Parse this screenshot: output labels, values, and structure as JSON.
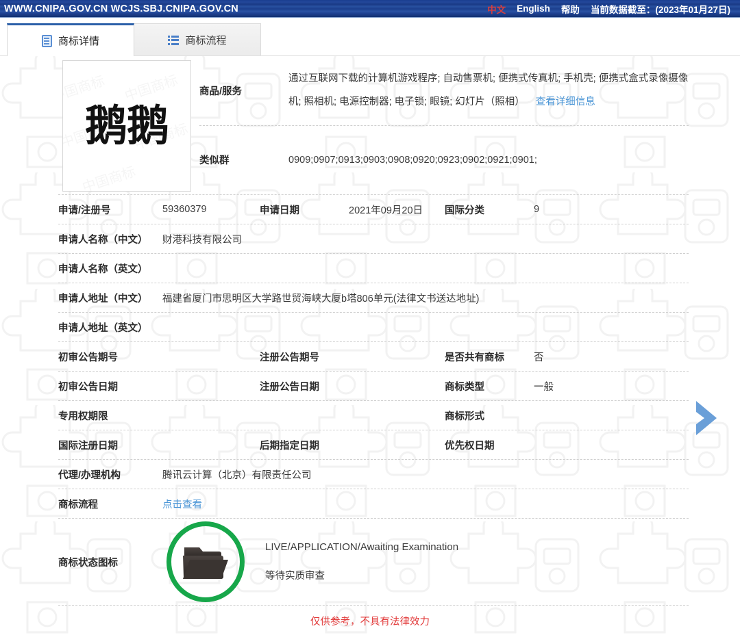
{
  "topbar": {
    "url": "WWW.CNIPA.GOV.CN WCJS.SBJ.CNIPA.GOV.CN",
    "lang_cn": "中文",
    "lang_en": "English",
    "help": "帮助",
    "data_date": "当前数据截至：(2023年01月27日)",
    "bg_color": "#1b3f8f",
    "cn_color": "#d63f3f"
  },
  "tabs": [
    {
      "label": "商标详情",
      "icon": "clipboard-icon",
      "active": true
    },
    {
      "label": "商标流程",
      "icon": "list-icon",
      "active": false
    }
  ],
  "mark": {
    "image_text": "鹅鹅",
    "watermark_text": "中国商标"
  },
  "goods": {
    "label": "商品/服务",
    "value": "通过互联网下载的计算机游戏程序; 自动售票机; 便携式传真机; 手机壳; 便携式盒式录像摄像机; 照相机; 电源控制器; 电子锁; 眼镜; 幻灯片（照相）",
    "detail_link": "查看详细信息"
  },
  "similar_group": {
    "label": "类似群",
    "value": "0909;0907;0913;0903;0908;0920;0923;0902;0921;0901;"
  },
  "fields": {
    "app_no": {
      "label": "申请/注册号",
      "value": "59360379"
    },
    "app_date": {
      "label": "申请日期",
      "value": "2021年09月20日"
    },
    "intl_class": {
      "label": "国际分类",
      "value": "9"
    },
    "applicant_cn": {
      "label": "申请人名称（中文）",
      "value": "财港科技有限公司"
    },
    "applicant_en": {
      "label": "申请人名称（英文）",
      "value": ""
    },
    "address_cn": {
      "label": "申请人地址（中文）",
      "value": "福建省厦门市思明区大学路世贸海峡大厦b塔806单元(法律文书送达地址)"
    },
    "address_en": {
      "label": "申请人地址（英文）",
      "value": ""
    },
    "prelim_issue": {
      "label": "初审公告期号",
      "value": ""
    },
    "reg_issue": {
      "label": "注册公告期号",
      "value": ""
    },
    "is_shared": {
      "label": "是否共有商标",
      "value": "否"
    },
    "prelim_date": {
      "label": "初审公告日期",
      "value": ""
    },
    "reg_date": {
      "label": "注册公告日期",
      "value": ""
    },
    "mark_type": {
      "label": "商标类型",
      "value": "一般"
    },
    "exclusive_period": {
      "label": "专用权期限",
      "value": ""
    },
    "mark_form": {
      "label": "商标形式",
      "value": ""
    },
    "intl_reg_date": {
      "label": "国际注册日期",
      "value": ""
    },
    "later_designation": {
      "label": "后期指定日期",
      "value": ""
    },
    "priority_date": {
      "label": "优先权日期",
      "value": ""
    },
    "agency": {
      "label": "代理/办理机构",
      "value": "腾讯云计算（北京）有限责任公司"
    },
    "process": {
      "label": "商标流程",
      "value": "点击查看"
    }
  },
  "status": {
    "label": "商标状态图标",
    "icon": "folder-icon",
    "ring_color": "#17a74a",
    "text_en": "LIVE/APPLICATION/Awaiting Examination",
    "text_cn": "等待实质审查"
  },
  "disclaimer": "仅供参考，不具有法律效力",
  "nav": {
    "next_icon": "chevron-right-icon",
    "color": "#6a9fd8"
  }
}
